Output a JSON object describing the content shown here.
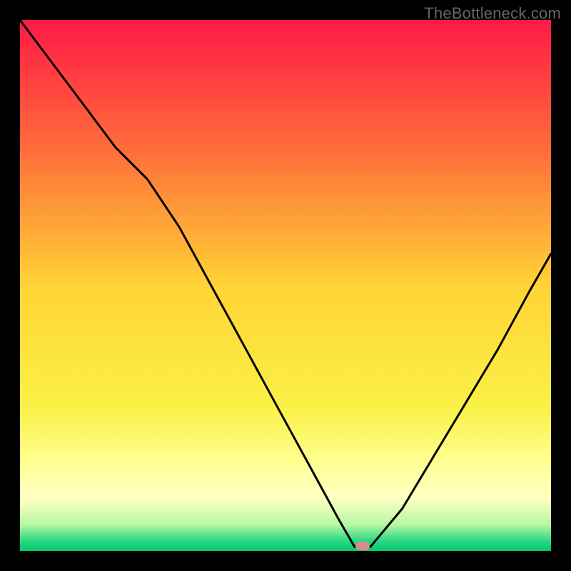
{
  "watermark": "TheBottleneck.com",
  "marker": {
    "x_pct": 64.5,
    "y_pct": 99.0,
    "color": "#d98b84"
  },
  "chart_data": {
    "type": "line",
    "title": "",
    "xlabel": "",
    "ylabel": "",
    "xlim": [
      0,
      100
    ],
    "ylim": [
      0,
      100
    ],
    "background_gradient": [
      {
        "pos": 0,
        "color": "#ff1946"
      },
      {
        "pos": 25,
        "color": "#ff6f3a"
      },
      {
        "pos": 50,
        "color": "#ffd335"
      },
      {
        "pos": 73,
        "color": "#faf147"
      },
      {
        "pos": 83,
        "color": "#ffff90"
      },
      {
        "pos": 90,
        "color": "#ffffc4"
      },
      {
        "pos": 95,
        "color": "#b9f7a2"
      },
      {
        "pos": 98,
        "color": "#2fd984"
      },
      {
        "pos": 100,
        "color": "#08c66e"
      }
    ],
    "series": [
      {
        "name": "bottleneck-curve",
        "color": "#000000",
        "x": [
          0,
          6,
          12,
          18,
          24,
          30,
          36,
          42,
          48,
          54,
          60,
          63,
          66,
          72,
          78,
          84,
          90,
          96,
          100
        ],
        "y": [
          100,
          92,
          84,
          76,
          70,
          61,
          50,
          39,
          28,
          17,
          6,
          0.8,
          0.8,
          8,
          18,
          28,
          38,
          49,
          56
        ]
      }
    ]
  }
}
